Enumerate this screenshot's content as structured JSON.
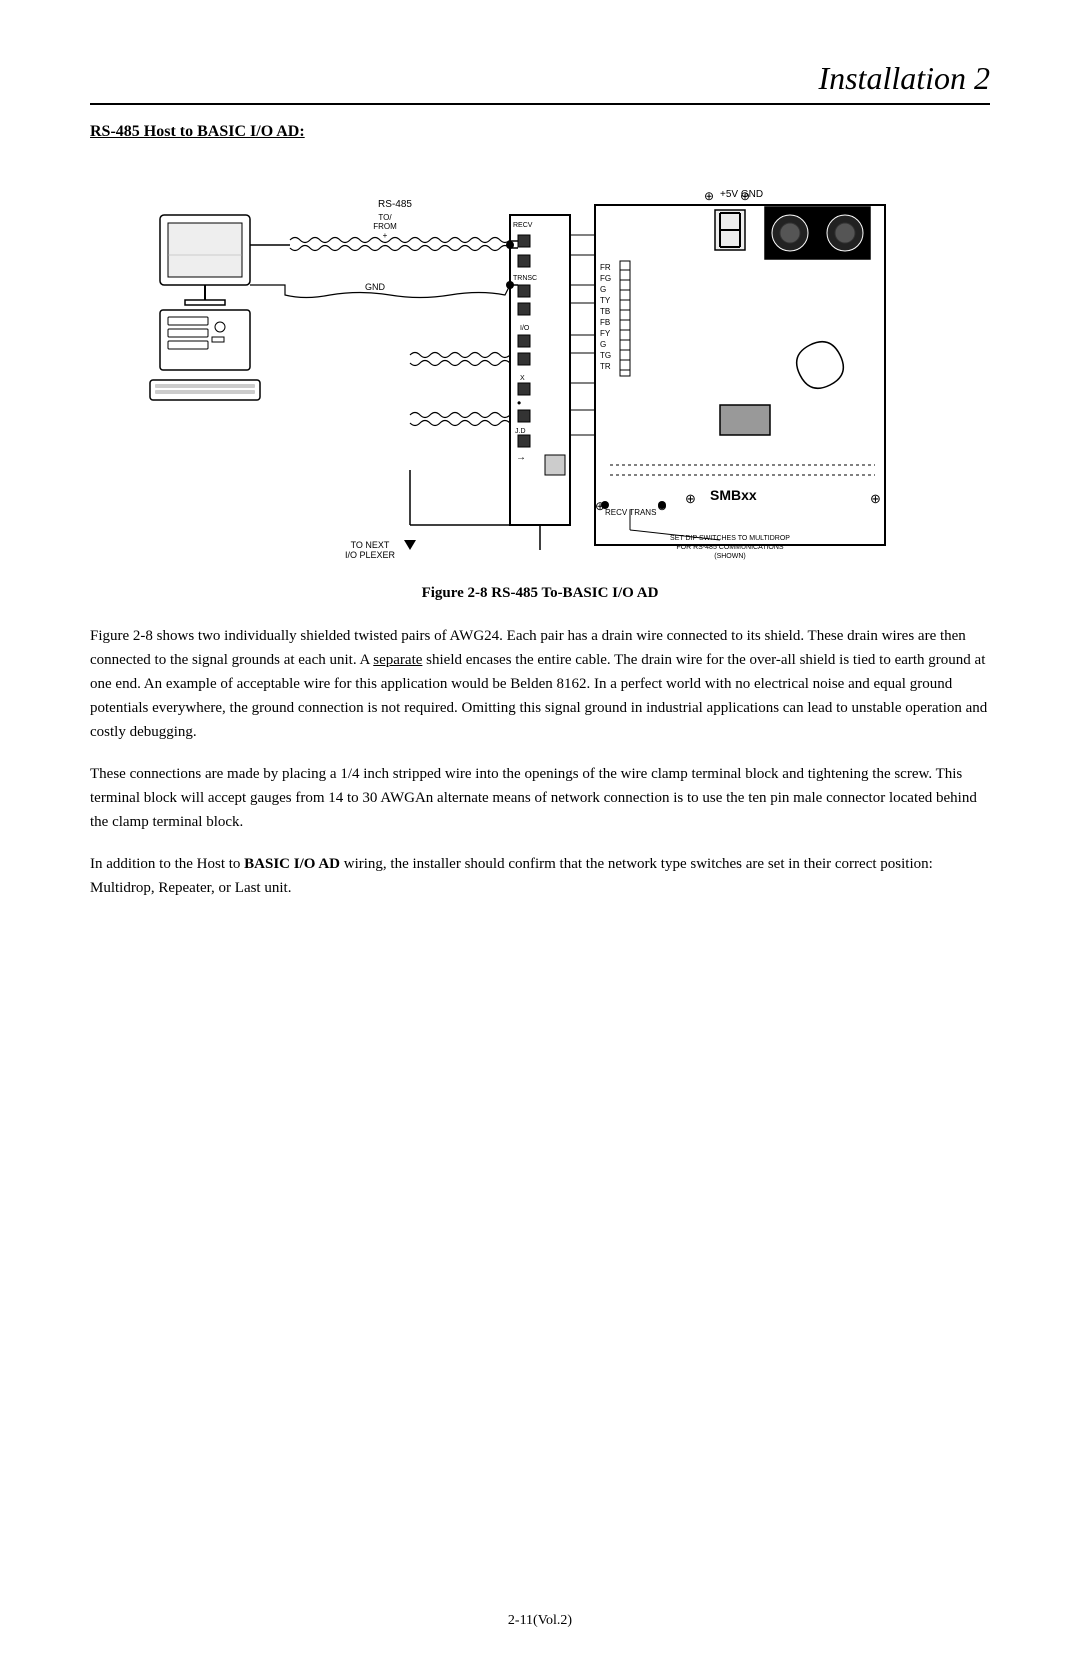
{
  "page": {
    "title": "Installation 2",
    "section_heading": "RS-485 Host to BASIC I/O AD:",
    "figure_caption": "Figure 2-8 RS-485 To-BASIC I/O AD",
    "paragraphs": [
      "Figure 2-8 shows two individually shielded twisted pairs of AWG24. Each pair has a drain wire connected to its shield. These drain wires are then connected to the signal grounds at each unit. A separate shield encases the entire cable. The drain wire for the over-all shield is tied to earth ground at one end. An example of acceptable wire for this application would be Belden 8162.  In a perfect world with no electrical noise and equal ground potentials everywhere, the ground connection is not required. Omitting this signal ground in industrial applications can lead to unstable operation and costly debugging.",
      "These connections are made by placing a 1/4 inch stripped wire into the openings of the wire clamp terminal block and tightening the screw. This terminal block will accept gauges from 14 to 30 AWGAn alternate means of network connection is to use the ten pin male connector located behind the clamp terminal block.",
      "In addition to the Host to BASIC I/O AD wiring, the installer should confirm that the network type switches are set in their correct position: Multidrop, Repeater, or Last unit."
    ],
    "footer": "2-11(Vol.2)"
  }
}
